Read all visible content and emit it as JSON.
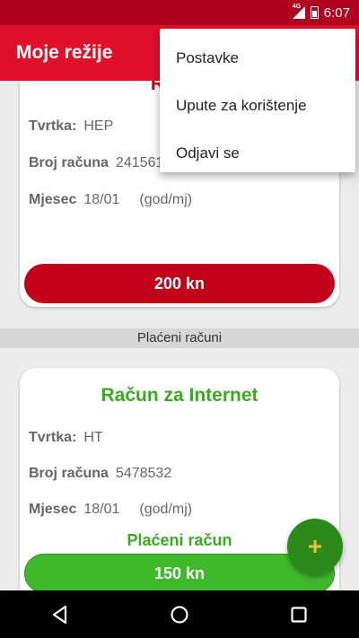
{
  "status_bar": {
    "time": "6:07",
    "network": "4G"
  },
  "app_bar": {
    "title": "Moje režije"
  },
  "unpaid_card": {
    "title": "Račun",
    "company_label": "Tvrtka:",
    "company_value": "HEP",
    "bill_label": "Broj računa",
    "bill_value": "24156122",
    "month_label": "Mjesec",
    "month_value": "18/01",
    "month_unit": "(god/mj)",
    "amount": "200 kn"
  },
  "section": {
    "paid_header": "Plaćeni računi"
  },
  "paid_card": {
    "title": "Račun za Internet",
    "company_label": "Tvrtka:",
    "company_value": "HT",
    "bill_label": "Broj računa",
    "bill_value": "5478532",
    "month_label": "Mjesec",
    "month_value": "18/01",
    "month_unit": "(god/mj)",
    "status": "Plaćeni račun",
    "amount": "150 kn"
  },
  "fab": {
    "icon": "plus-icon",
    "label": "+"
  },
  "overflow_menu": {
    "items": [
      {
        "label": "Postavke"
      },
      {
        "label": "Upute za korištenje"
      },
      {
        "label": "Odjavi se"
      }
    ]
  },
  "nav_bar": {
    "icons": [
      "back-icon",
      "home-icon",
      "recents-icon"
    ]
  },
  "colors": {
    "status_bar": "#b0001e",
    "app_bar": "#e0102b",
    "unpaid_accent": "#c2001a",
    "paid_accent": "#3aaa1f",
    "fab": "#2c8a1a"
  }
}
